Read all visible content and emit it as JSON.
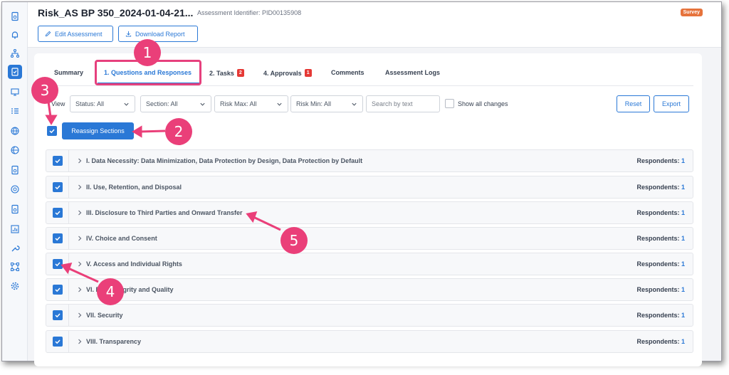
{
  "header": {
    "title": "Risk_AS BP 350_2024-01-04-21...",
    "assessment_id": "Assessment Identifier: PID00135908",
    "badge": "Survey",
    "edit_label": "Edit Assessment",
    "download_label": "Download Report"
  },
  "tabs": [
    {
      "label": "Summary"
    },
    {
      "label": "1. Questions and Responses"
    },
    {
      "label": "2. Tasks",
      "badge": "2"
    },
    {
      "label": "4. Approvals",
      "badge": "1"
    },
    {
      "label": "Comments"
    },
    {
      "label": "Assessment Logs"
    }
  ],
  "filters": {
    "view_label": "View",
    "status": "Status: All",
    "section": "Section: All",
    "risk_max": "Risk Max: All",
    "risk_min": "Risk Min: All",
    "search_placeholder": "Search by text",
    "show_changes": "Show all changes",
    "reset": "Reset",
    "export": "Export"
  },
  "reassign_label": "Reassign Sections",
  "respondents_label": "Respondents:",
  "sections": [
    {
      "title": "I. Data Necessity: Data Minimization, Data Protection by Design, Data Protection by Default",
      "respondents": "1"
    },
    {
      "title": "II. Use, Retention, and Disposal",
      "respondents": "1"
    },
    {
      "title": "III. Disclosure to Third Parties and Onward Transfer",
      "respondents": "1"
    },
    {
      "title": "IV. Choice and Consent",
      "respondents": "1"
    },
    {
      "title": "V. Access and Individual Rights",
      "respondents": "1"
    },
    {
      "title": "VI. Data Integrity and Quality",
      "respondents": "1"
    },
    {
      "title": "VII. Security",
      "respondents": "1"
    },
    {
      "title": "VIII. Transparency",
      "respondents": "1"
    }
  ],
  "callouts": [
    "1",
    "2",
    "3",
    "4",
    "5"
  ],
  "colors": {
    "accent": "#2a78d6",
    "callout": "#ea3f79",
    "badge_red": "#e53935",
    "survey_orange": "#e6733c"
  },
  "sidebar_icons": [
    "document-icon",
    "bell-icon",
    "network-icon",
    "assessment-icon",
    "presentation-icon",
    "list-icon",
    "globe-icon",
    "globe-icon",
    "document-icon",
    "globe-icon",
    "document-icon",
    "chart-icon",
    "wrench-icon",
    "workflow-icon",
    "settings-icon"
  ]
}
